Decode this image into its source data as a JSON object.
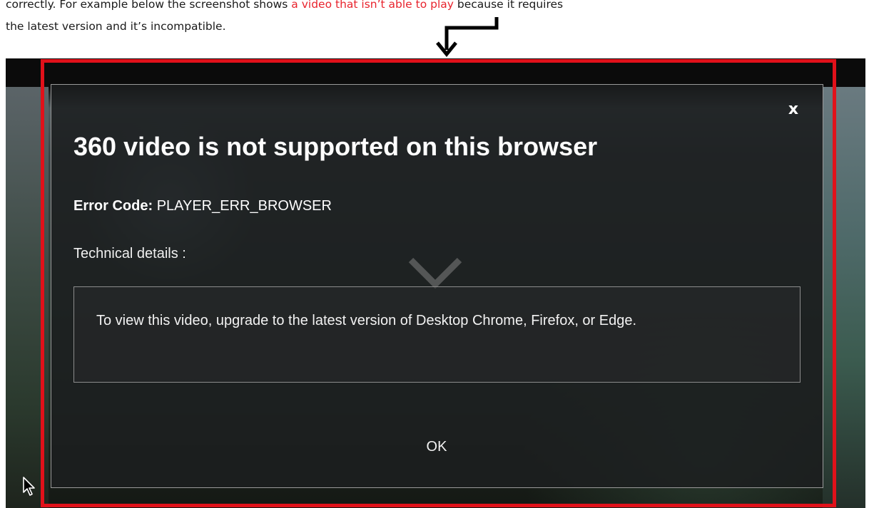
{
  "doc": {
    "line1_part1": "correctly. For example below the screenshot shows ",
    "line1_highlight": "a video that isn’t able to play",
    "line1_part2": " because it requires",
    "line2": "the latest version and it’s incompatible."
  },
  "dialog": {
    "close_label": "x",
    "title": "360 video is not supported on this browser",
    "error_code_label": "Error Code:",
    "error_code_value": "PLAYER_ERR_BROWSER",
    "technical_details_label": "Technical details :",
    "details_message": "To view this video, upgrade to the latest version of Desktop Chrome, Firefox, or Edge.",
    "ok_label": "OK"
  },
  "colors": {
    "highlight_red": "#e1111a",
    "doc_red_text": "#e8232d",
    "dialog_bg": "#1c1e1f"
  },
  "icons": [
    "down-arrow-icon",
    "close-icon",
    "chevron-down-icon",
    "mouse-cursor-icon"
  ]
}
